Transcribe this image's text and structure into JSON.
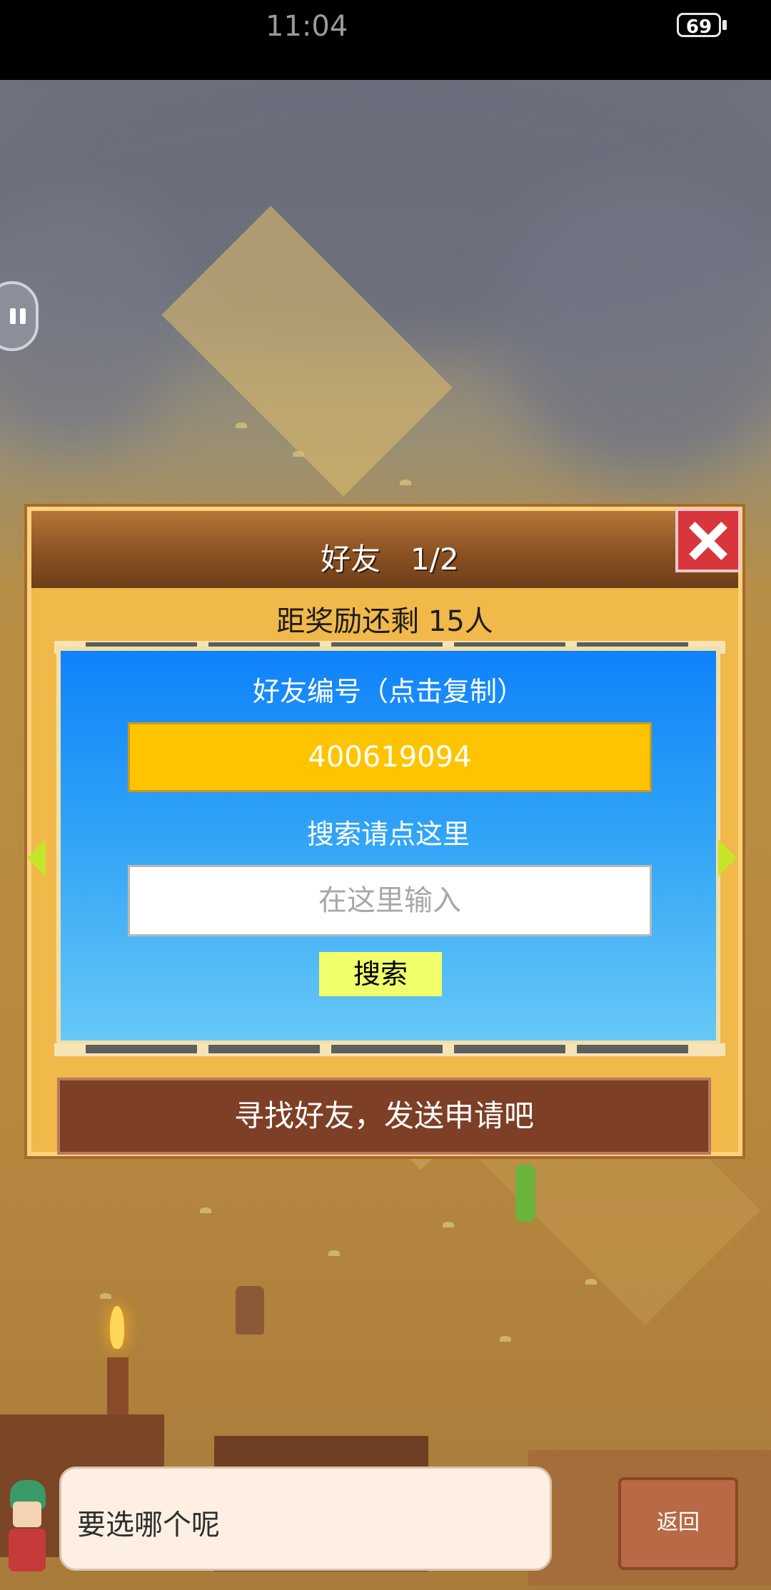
{
  "status_bar": {
    "time": "11:04",
    "battery": "69"
  },
  "dialog": {
    "title": "好友　1/2",
    "reward_text": "距奖励还剩 15人",
    "friend_id_label": "好友编号（点击复制）",
    "friend_id": "400619094",
    "search_label": "搜索请点这里",
    "search_placeholder": "在这里输入",
    "search_value": "",
    "search_button": "搜索",
    "find_friends_button": "寻找好友，发送申请吧"
  },
  "bottom": {
    "speech_text": "要选哪个呢",
    "back_button": "返回"
  },
  "colors": {
    "dialog_bg": "#f1b84a",
    "blue_panel": "#0f82fb",
    "id_box": "#ffc400",
    "search_button": "#f0ff6a",
    "close_button": "#d8363c",
    "find_bar": "#7e3f27"
  }
}
